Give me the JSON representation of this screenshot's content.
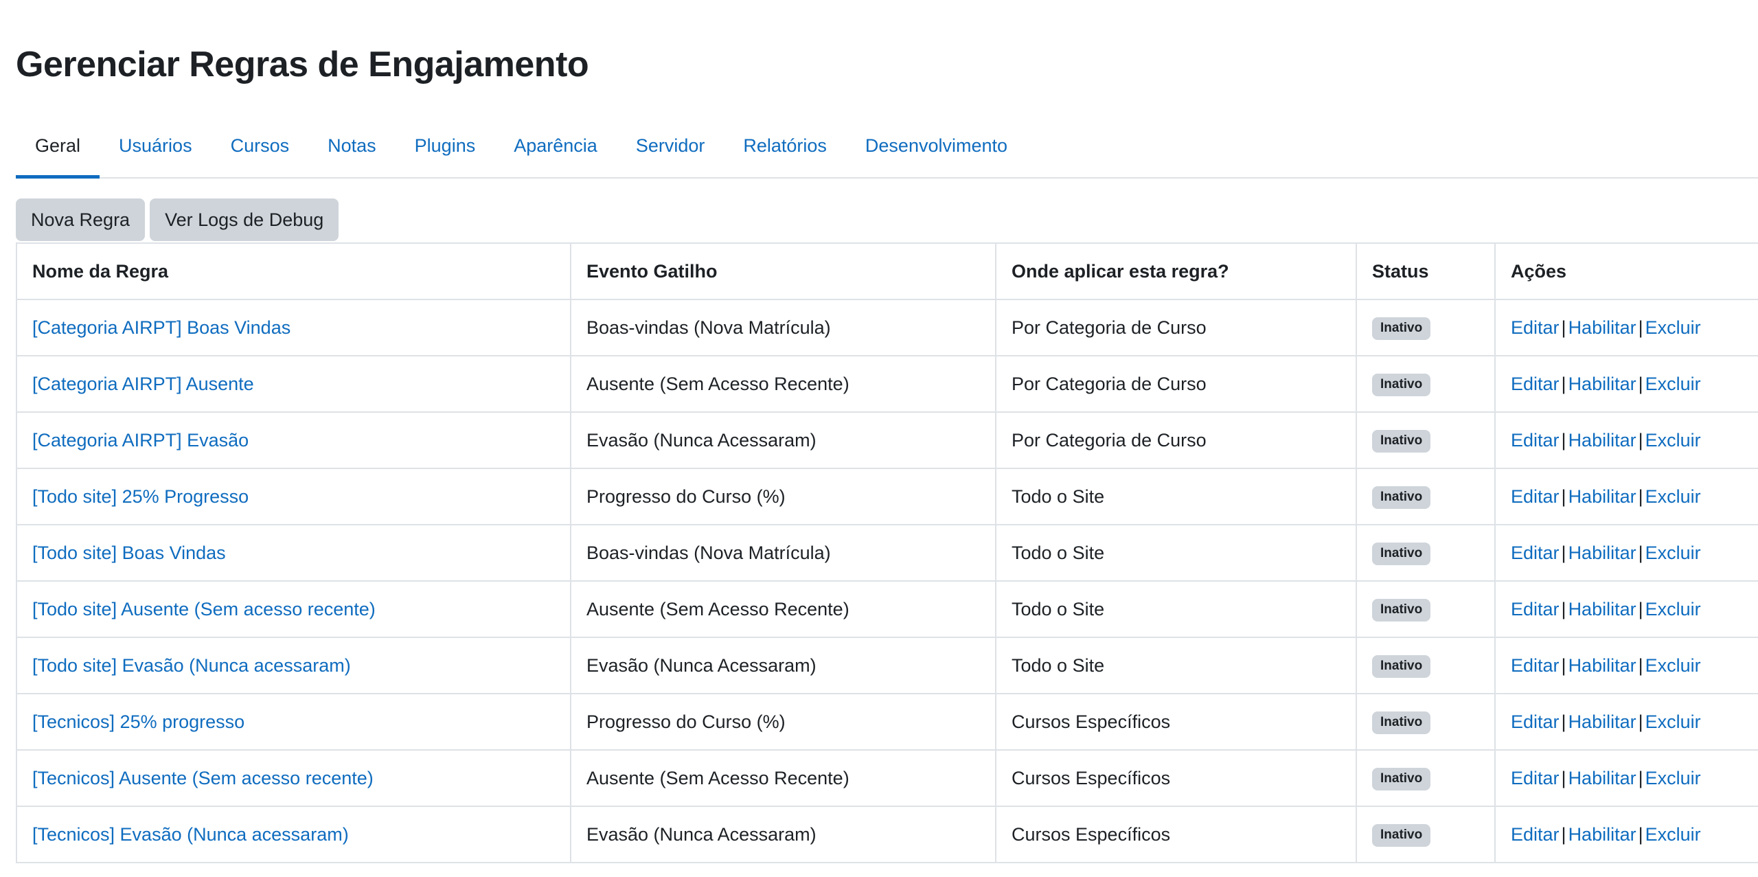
{
  "page_title": "Gerenciar Regras de Engajamento",
  "tabs": [
    {
      "label": "Geral",
      "active": true
    },
    {
      "label": "Usuários",
      "active": false
    },
    {
      "label": "Cursos",
      "active": false
    },
    {
      "label": "Notas",
      "active": false
    },
    {
      "label": "Plugins",
      "active": false
    },
    {
      "label": "Aparência",
      "active": false
    },
    {
      "label": "Servidor",
      "active": false
    },
    {
      "label": "Relatórios",
      "active": false
    },
    {
      "label": "Desenvolvimento",
      "active": false
    }
  ],
  "toolbar": {
    "new_rule_label": "Nova Regra",
    "debug_logs_label": "Ver Logs de Debug"
  },
  "table": {
    "headers": {
      "name": "Nome da Regra",
      "trigger": "Evento Gatilho",
      "scope": "Onde aplicar esta regra?",
      "status": "Status",
      "actions": "Ações"
    },
    "action_labels": {
      "edit": "Editar",
      "enable": "Habilitar",
      "delete": "Excluir",
      "separator": "|"
    },
    "rows": [
      {
        "name": "[Categoria AIRPT] Boas Vindas",
        "trigger": "Boas-vindas (Nova Matrícula)",
        "scope": "Por Categoria de Curso",
        "status": "Inativo"
      },
      {
        "name": "[Categoria AIRPT] Ausente",
        "trigger": "Ausente (Sem Acesso Recente)",
        "scope": "Por Categoria de Curso",
        "status": "Inativo"
      },
      {
        "name": "[Categoria AIRPT] Evasão",
        "trigger": "Evasão (Nunca Acessaram)",
        "scope": "Por Categoria de Curso",
        "status": "Inativo"
      },
      {
        "name": "[Todo site] 25% Progresso",
        "trigger": "Progresso do Curso (%)",
        "scope": "Todo o Site",
        "status": "Inativo"
      },
      {
        "name": "[Todo site] Boas Vindas",
        "trigger": "Boas-vindas (Nova Matrícula)",
        "scope": "Todo o Site",
        "status": "Inativo"
      },
      {
        "name": "[Todo site] Ausente (Sem acesso recente)",
        "trigger": "Ausente (Sem Acesso Recente)",
        "scope": "Todo o Site",
        "status": "Inativo"
      },
      {
        "name": "[Todo site] Evasão (Nunca acessaram)",
        "trigger": "Evasão (Nunca Acessaram)",
        "scope": "Todo o Site",
        "status": "Inativo"
      },
      {
        "name": "[Tecnicos] 25% progresso",
        "trigger": "Progresso do Curso (%)",
        "scope": "Cursos Específicos",
        "status": "Inativo"
      },
      {
        "name": "[Tecnicos] Ausente (Sem acesso recente)",
        "trigger": "Ausente (Sem Acesso Recente)",
        "scope": "Cursos Específicos",
        "status": "Inativo"
      },
      {
        "name": "[Tecnicos] Evasão (Nunca acessaram)",
        "trigger": "Evasão (Nunca Acessaram)",
        "scope": "Cursos Específicos",
        "status": "Inativo"
      }
    ]
  },
  "colors": {
    "link": "#0f6cbf",
    "text": "#1d2125",
    "badge_bg": "#ced4da",
    "border": "#dee2e6"
  }
}
